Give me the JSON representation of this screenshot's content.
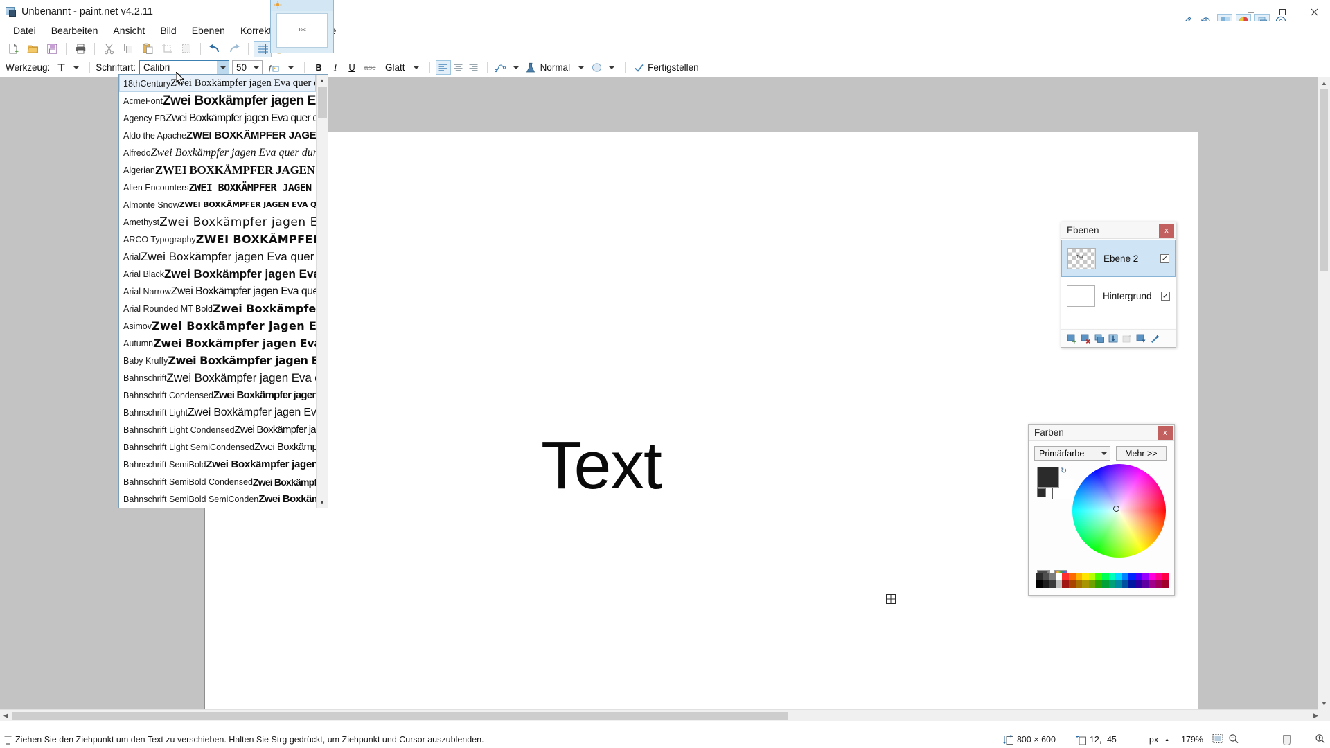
{
  "window": {
    "title": "Unbenannt - paint.net v4.2.11",
    "minimize": "–",
    "maximize": "☐",
    "close": "✕"
  },
  "menubar": {
    "items": [
      {
        "label": "Datei"
      },
      {
        "label": "Bearbeiten"
      },
      {
        "label": "Ansicht"
      },
      {
        "label": "Bild"
      },
      {
        "label": "Ebenen"
      },
      {
        "label": "Korrekturen"
      },
      {
        "label": "Effekte"
      }
    ]
  },
  "titlebar_tools": [
    {
      "name": "settings-icon"
    },
    {
      "name": "history-icon"
    },
    {
      "name": "tools-window-icon"
    },
    {
      "name": "colors-window-icon"
    },
    {
      "name": "layers-window-icon"
    },
    {
      "name": "help-icon"
    }
  ],
  "toolbar": {
    "buttons": [
      {
        "name": "new-icon"
      },
      {
        "name": "open-icon"
      },
      {
        "name": "save-icon"
      },
      {
        "name": "print-icon"
      },
      {
        "name": "cut-icon"
      },
      {
        "name": "copy-icon"
      },
      {
        "name": "paste-icon"
      },
      {
        "name": "crop-to-selection-icon"
      },
      {
        "name": "deselect-icon"
      },
      {
        "name": "undo-icon"
      },
      {
        "name": "redo-icon"
      },
      {
        "name": "grid-icon"
      },
      {
        "name": "rulers-icon"
      }
    ]
  },
  "tool_options": {
    "tool_label": "Werkzeug:",
    "tool_icon": "text-tool-icon",
    "font_label": "Schriftart:",
    "font_value": "Calibri",
    "size_value": "50",
    "font_fx_icon": "font-effects-icon",
    "bold": "B",
    "italic": "I",
    "underline": "U",
    "strikethrough": "abc",
    "antialias_label": "Glatt",
    "align_left_icon": "align-left-icon",
    "align_center_icon": "align-center-icon",
    "align_right_icon": "align-right-icon",
    "blend_icon": "blend-mode-icon",
    "flask_icon": "flask-icon",
    "blend_value": "Normal",
    "shape_icon": "antialias-shape-icon",
    "finish_label": "Fertigstellen",
    "finish_icon": "checkmark-icon"
  },
  "font_dropdown": {
    "scroll_up_icon": "chevron-up-icon",
    "scroll_down_icon": "chevron-down-icon",
    "sample_text": "Zwei Boxkämpfer jagen Eva quer durch Sylt",
    "items": [
      {
        "name": "18thCentury",
        "selected": true
      },
      {
        "name": "AcmeFont",
        "selected": false
      },
      {
        "name": "Agency FB",
        "selected": false
      },
      {
        "name": "Aldo the Apache",
        "selected": false
      },
      {
        "name": "Alfredo",
        "selected": false
      },
      {
        "name": "Algerian",
        "selected": false
      },
      {
        "name": "Alien Encounters",
        "selected": false
      },
      {
        "name": "Almonte Snow",
        "selected": false
      },
      {
        "name": "Amethyst",
        "selected": false
      },
      {
        "name": "ARCO Typography",
        "selected": false
      },
      {
        "name": "Arial",
        "selected": false
      },
      {
        "name": "Arial Black",
        "selected": false
      },
      {
        "name": "Arial Narrow",
        "selected": false
      },
      {
        "name": "Arial Rounded MT Bold",
        "selected": false
      },
      {
        "name": "Asimov",
        "selected": false
      },
      {
        "name": "Autumn",
        "selected": false
      },
      {
        "name": "Baby Kruffy",
        "selected": false
      },
      {
        "name": "Bahnschrift",
        "selected": false
      },
      {
        "name": "Bahnschrift Condensed",
        "selected": false
      },
      {
        "name": "Bahnschrift Light",
        "selected": false
      },
      {
        "name": "Bahnschrift Light Condensed",
        "selected": false
      },
      {
        "name": "Bahnschrift Light SemiCondensed",
        "selected": false
      },
      {
        "name": "Bahnschrift SemiBold",
        "selected": false
      },
      {
        "name": "Bahnschrift SemiBold Condensed",
        "selected": false
      },
      {
        "name": "Bahnschrift SemiBold SemiConden",
        "selected": false
      }
    ]
  },
  "canvas": {
    "text": "Text",
    "move_handle_icon": "move-handle-icon"
  },
  "layers_panel": {
    "title": "Ebenen",
    "close": "x",
    "layers": [
      {
        "name": "Ebene 2",
        "visible": "✓",
        "selected": true
      },
      {
        "name": "Hintergrund",
        "visible": "✓",
        "selected": false
      }
    ],
    "tools": [
      {
        "name": "add-layer-icon"
      },
      {
        "name": "delete-layer-icon"
      },
      {
        "name": "duplicate-layer-icon"
      },
      {
        "name": "merge-layer-down-icon"
      },
      {
        "name": "move-layer-up-icon"
      },
      {
        "name": "move-layer-down-icon"
      },
      {
        "name": "layer-properties-icon"
      }
    ]
  },
  "colors_panel": {
    "title": "Farben",
    "close": "x",
    "mode_value": "Primärfarbe",
    "more_label": "Mehr >>",
    "primary_color": "#2b2b2b",
    "secondary_color": "#ffffff",
    "swap_icon": "swap-colors-icon",
    "palette_open_icon": "open-palette-icon",
    "palette_icon": "palette-icon",
    "palette_dropdown_icon": "chevron-down-icon"
  },
  "statusbar": {
    "tool_icon": "text-tool-icon",
    "help_text": "Ziehen Sie den Ziehpunkt um den Text zu verschieben. Halten Sie Strg gedrückt, um Ziehpunkt und Cursor auszublenden.",
    "image_size_icon": "image-size-icon",
    "image_size": "800 × 600",
    "cursor_pos_icon": "cursor-position-icon",
    "cursor_pos": "12, -45",
    "unit": "px",
    "unit_arrow": "▲",
    "zoom_level": "179%",
    "fit_icon": "fit-to-window-icon",
    "zoom_out_icon": "zoom-out-icon",
    "zoom_in_icon": "zoom-in-icon"
  }
}
